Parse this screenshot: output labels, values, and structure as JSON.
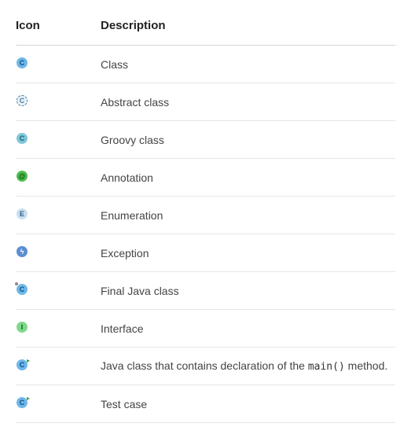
{
  "headers": {
    "icon": "Icon",
    "description": "Description"
  },
  "rows": [
    {
      "icon_name": "class-icon",
      "letter": "C",
      "bg": "#6fb7e9",
      "fg": "#0d4f80",
      "dashed": false,
      "overlay": "none",
      "text": "Class",
      "code": ""
    },
    {
      "icon_name": "abstract-class-icon",
      "letter": "C",
      "bg": "#cfe8f7",
      "fg": "#4a7a9a",
      "dashed": true,
      "overlay": "none",
      "text": "Abstract class",
      "code": ""
    },
    {
      "icon_name": "groovy-class-icon",
      "letter": "C",
      "bg": "#7fc6d9",
      "fg": "#1f5d6d",
      "dashed": false,
      "overlay": "none",
      "text": "Groovy class",
      "code": ""
    },
    {
      "icon_name": "annotation-icon",
      "letter": "@",
      "bg": "#4fbf4f",
      "fg": "#0c4d0c",
      "dashed": false,
      "overlay": "none",
      "text": "Annotation",
      "code": ""
    },
    {
      "icon_name": "enumeration-icon",
      "letter": "E",
      "bg": "#c9dff0",
      "fg": "#2d5f87",
      "dashed": false,
      "overlay": "none",
      "text": "Enumeration",
      "code": ""
    },
    {
      "icon_name": "exception-icon",
      "letter": "ϟ",
      "bg": "#5b8fd1",
      "fg": "#ffffff",
      "dashed": false,
      "overlay": "none",
      "text": "Exception",
      "code": ""
    },
    {
      "icon_name": "final-class-icon",
      "letter": "C",
      "bg": "#6fb7e9",
      "fg": "#0d4f80",
      "dashed": false,
      "overlay": "pin",
      "text": "Final Java class",
      "code": ""
    },
    {
      "icon_name": "interface-icon",
      "letter": "I",
      "bg": "#7fd98b",
      "fg": "#115c1b",
      "dashed": false,
      "overlay": "none",
      "text": "Interface",
      "code": ""
    },
    {
      "icon_name": "main-class-icon",
      "letter": "C",
      "bg": "#6fb7e9",
      "fg": "#0d4f80",
      "dashed": false,
      "overlay": "arrow",
      "arrow_color": "#2e9e3b",
      "text": "Java class that contains declaration of the ",
      "code": "main()",
      "text_after": " method."
    },
    {
      "icon_name": "test-case-icon",
      "letter": "C",
      "bg": "#6fb7e9",
      "fg": "#0d4f80",
      "dashed": false,
      "overlay": "arrow",
      "arrow_color": "#2e9e3b",
      "text": "Test case",
      "code": ""
    }
  ]
}
